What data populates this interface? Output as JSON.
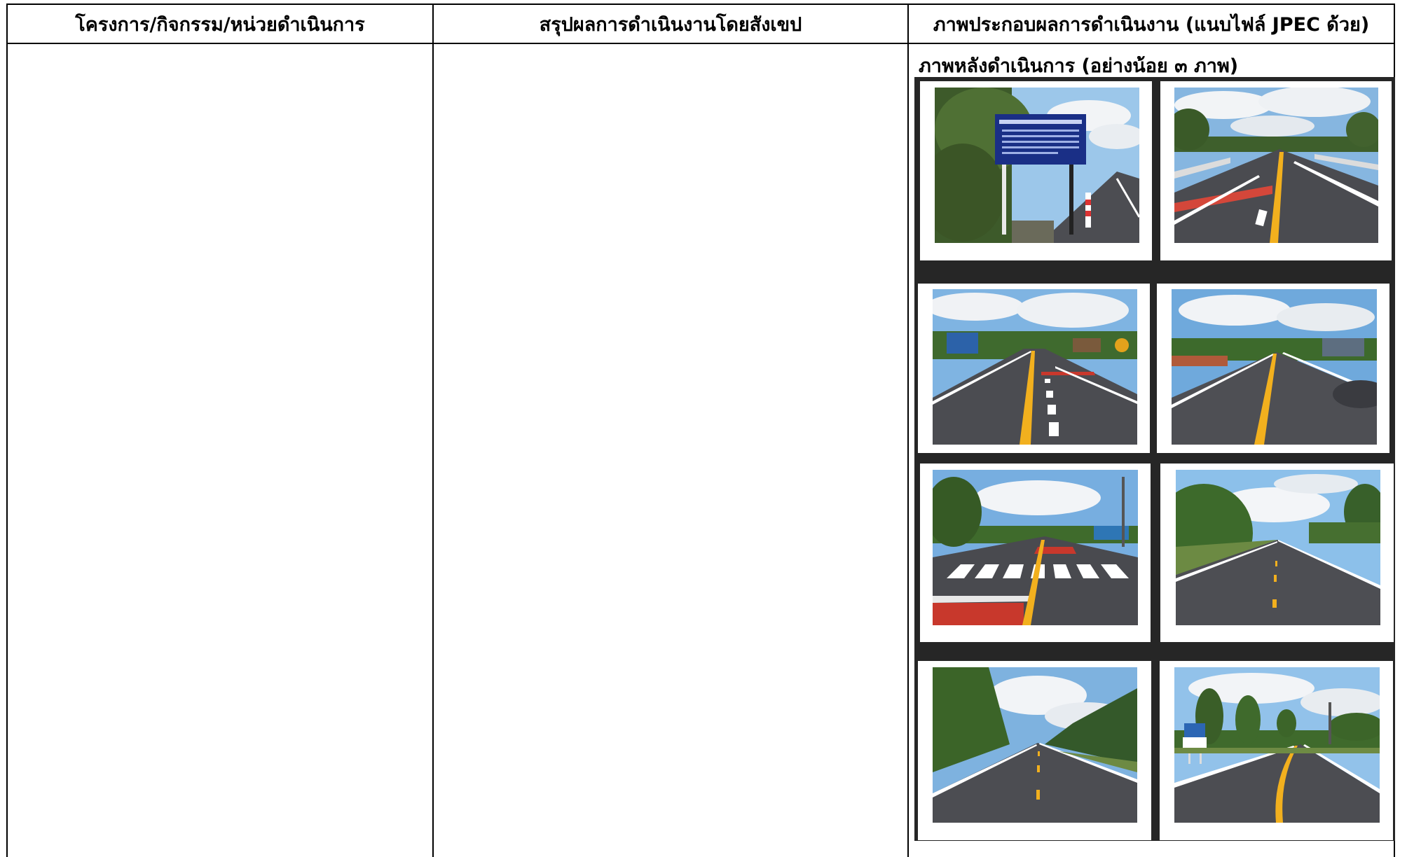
{
  "table": {
    "headers": [
      "โครงการ/กิจกรรม/หน่วยดำเนินการ",
      "สรุปผลการดำเนินงานโดยสังเขป",
      "ภาพประกอบผลการดำเนินงาน (แนบไฟล์ JPEC ด้วย)"
    ],
    "cells": {
      "project": "",
      "summary": ""
    },
    "photos_caption": "ภาพหลังดำเนินการ (อย่างน้อย ๓ ภาพ)"
  },
  "photos": [
    {
      "id": "sign-board",
      "scene": "roadside project sign board"
    },
    {
      "id": "bridge-road",
      "scene": "road over bridge with red marking"
    },
    {
      "id": "village-road-crosswalk",
      "scene": "village road with red marking and dashed lines"
    },
    {
      "id": "village-road",
      "scene": "village road with yellow center line"
    },
    {
      "id": "zebra-crossing",
      "scene": "road with zebra crossing and red surface"
    },
    {
      "id": "rural-road-1",
      "scene": "rural road with trees"
    },
    {
      "id": "rural-road-2",
      "scene": "rural road through plantation"
    },
    {
      "id": "rural-road-curve",
      "scene": "rural road curve with blue sign"
    }
  ],
  "colors": {
    "border": "#000000",
    "photo_board": "#262626",
    "road": "#4a4b4f",
    "center_line": "#f2b01e",
    "red_marking": "#c8382c",
    "sky": "#8fbfe6"
  }
}
